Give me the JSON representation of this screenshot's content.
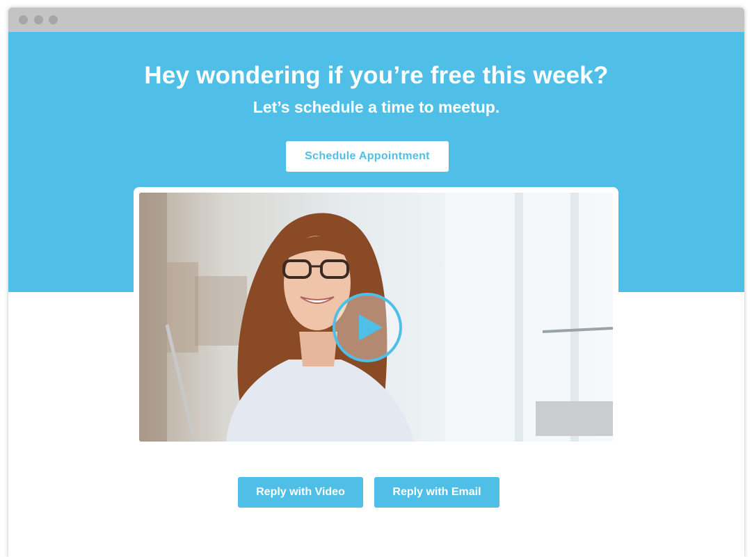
{
  "hero": {
    "headline": "Hey wondering if you’re free this week?",
    "subhead": "Let’s schedule a time to meetup.",
    "schedule_button": "Schedule Appointment"
  },
  "video": {
    "play_icon": "play-icon",
    "subject": "smiling woman with glasses in office"
  },
  "actions": {
    "reply_video": "Reply with Video",
    "reply_email": "Reply with Email"
  },
  "colors": {
    "accent": "#4fbfe8",
    "titlebar": "#c4c4c4",
    "window_dots": "#a6a6a6",
    "background": "#ffffff"
  }
}
